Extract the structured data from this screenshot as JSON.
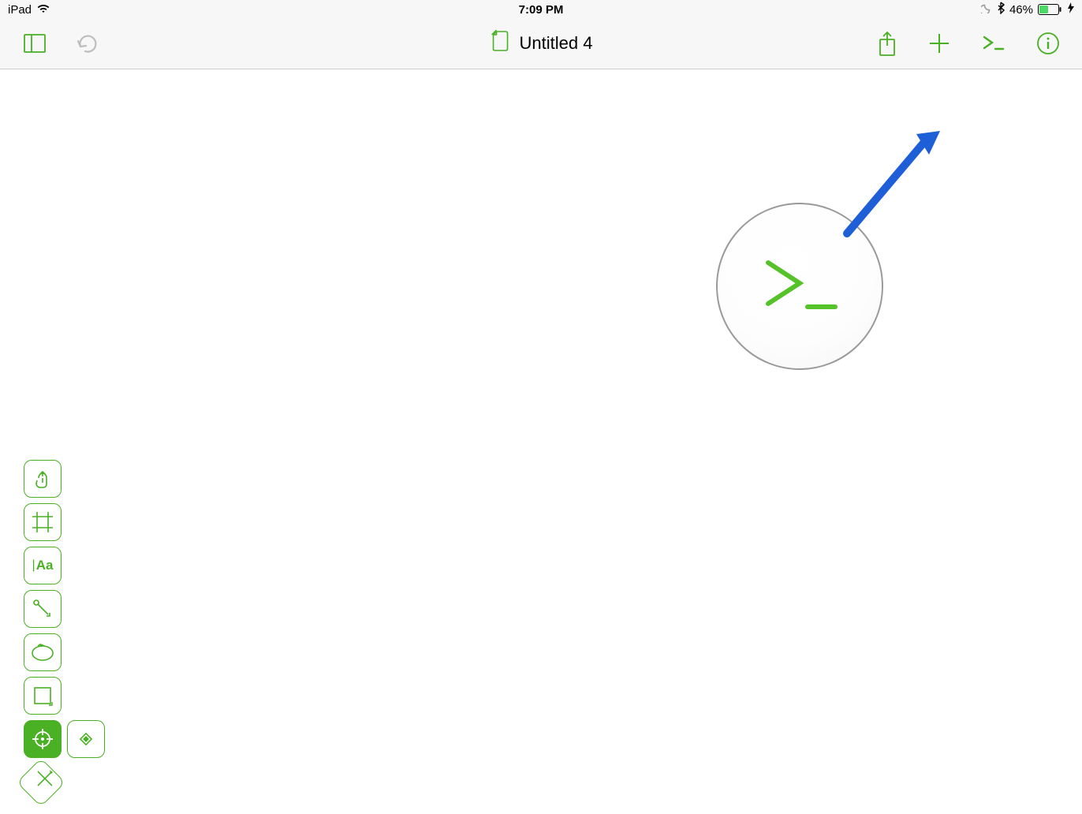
{
  "statusBar": {
    "deviceName": "iPad",
    "time": "7:09 PM",
    "batteryPercent": "46%"
  },
  "toolbar": {
    "documentTitle": "Untitled 4"
  },
  "toolPalette": {
    "textToolLabel": "Aa"
  },
  "colors": {
    "accent": "#4ab024",
    "arrowBlue": "#1e5fd8"
  }
}
